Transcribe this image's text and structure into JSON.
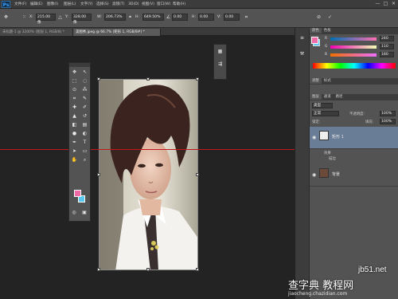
{
  "app": {
    "logo": "Ps"
  },
  "menu": [
    "文件(F)",
    "编辑(E)",
    "图像(I)",
    "图层(L)",
    "文字(Y)",
    "选择(S)",
    "滤镜(T)",
    "3D(D)",
    "视图(V)",
    "窗口(W)",
    "帮助(H)"
  ],
  "window_controls": [
    "—",
    "□",
    "✕"
  ],
  "options": {
    "x_label": "X:",
    "x_value": "215.00 像",
    "y_label": "Y:",
    "y_value": "328.00 像",
    "w_label": "W:",
    "w_value": "206.73%",
    "h_label": "H:",
    "h_value": "649.50%",
    "rot_value": "0.00",
    "h2_label": "H:",
    "h2_value": "0.00",
    "v_label": "V:",
    "v_value": "0.00",
    "interp_value": "两次立方",
    "cancel": "⊘",
    "commit": "✓"
  },
  "tabs": [
    {
      "label": "未标题-1 @ 3200% (图层 1, RGB/8) *",
      "active": false
    },
    {
      "label": "美图秀.jpeg @ 66.7% (矩形 1, RGB/8#) *",
      "active": true
    }
  ],
  "color_panel": {
    "tabs": [
      "颜色",
      "色板"
    ],
    "r_label": "R",
    "g_label": "G",
    "b_label": "B",
    "r_value": "240",
    "g_value": "110",
    "b_value": "180",
    "fg": "#f06aa8",
    "bg": "#5ac8f0"
  },
  "adjust_panel": {
    "tabs": [
      "调整",
      "样式"
    ]
  },
  "layers_panel": {
    "tabs": [
      "图层",
      "通道",
      "路径"
    ],
    "filter_label": "类型",
    "blend_mode": "正常",
    "opacity_label": "不透明度:",
    "opacity_value": "100%",
    "lock_label": "锁定:",
    "fill_label": "填充:",
    "fill_value": "100%",
    "layers": [
      {
        "name": "矩形 1",
        "effects_label": "效果",
        "effect_item": "描边"
      },
      {
        "name": "背景"
      }
    ]
  },
  "watermark": {
    "text1": "jb51.net",
    "text2": "查字典 教程网",
    "text3": "jiaocheng.chazidian.com"
  }
}
